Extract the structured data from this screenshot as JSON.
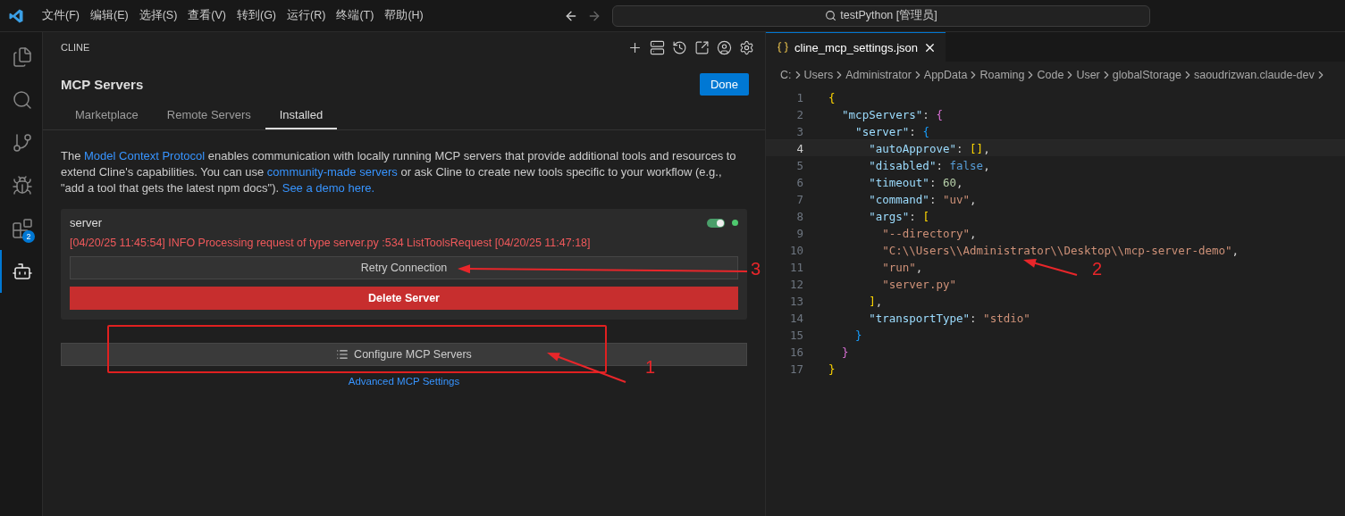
{
  "titlebar": {
    "menu": [
      "文件(F)",
      "编辑(E)",
      "选择(S)",
      "查看(V)",
      "转到(G)",
      "运行(R)",
      "终端(T)",
      "帮助(H)"
    ],
    "command_center": "testPython [管理员]"
  },
  "activity_bar": [
    {
      "kind": "explorer",
      "selected": false
    },
    {
      "kind": "search",
      "selected": false
    },
    {
      "kind": "source-control",
      "selected": false
    },
    {
      "kind": "run-debug",
      "selected": false
    },
    {
      "kind": "extensions",
      "selected": false,
      "badge": "2"
    },
    {
      "kind": "robot",
      "selected": true
    }
  ],
  "panel": {
    "title": "CLINE",
    "toolbar": [
      {
        "kind": "plus"
      },
      {
        "kind": "list"
      },
      {
        "kind": "history"
      },
      {
        "kind": "external"
      },
      {
        "kind": "account"
      },
      {
        "kind": "settings"
      }
    ],
    "heading": "MCP Servers",
    "done": "Done",
    "tabs": [
      {
        "label": "Marketplace",
        "selected": false
      },
      {
        "label": "Remote Servers",
        "selected": false
      },
      {
        "label": "Installed",
        "selected": true
      }
    ],
    "description": [
      {
        "text": "The ",
        "link": false
      },
      {
        "text": "Model Context Protocol",
        "link": true
      },
      {
        "text": " enables communication with locally running MCP servers that provide additional tools and resources to extend Cline's capabilities. You can use ",
        "link": false
      },
      {
        "text": "community-made servers",
        "link": true
      },
      {
        "text": " or ask Cline to create new tools specific to your workflow (e.g., \"add a tool that gets the latest npm docs\"). ",
        "link": false
      },
      {
        "text": "See a demo here.",
        "link": true
      }
    ],
    "server": {
      "name": "server",
      "on": true,
      "connected": true,
      "log": "[04/20/25 11:45:54] INFO Processing request of type server.py :534 ListToolsRequest [04/20/25 11:47:18]",
      "retry": "Retry Connection",
      "delete": "Delete Server"
    },
    "configure": "Configure MCP Servers",
    "advanced": "Advanced MCP Settings"
  },
  "editor": {
    "tab": "cline_mcp_settings.json",
    "breadcrumb": [
      "C:",
      "Users",
      "Administrator",
      "AppData",
      "Roaming",
      "Code",
      "User",
      "globalStorage",
      "saoudrizwan.claude-dev"
    ],
    "lines": [
      {
        "number": "1",
        "current": false,
        "tokens": [
          {
            "kind": "b1",
            "text": "{"
          }
        ]
      },
      {
        "number": "2",
        "current": false,
        "tokens": [
          {
            "kind": "key",
            "text": "  \"mcpServers\""
          },
          {
            "kind": "p",
            "text": ": "
          },
          {
            "kind": "b2",
            "text": "{"
          }
        ]
      },
      {
        "number": "3",
        "current": false,
        "tokens": [
          {
            "kind": "key",
            "text": "    \"server\""
          },
          {
            "kind": "p",
            "text": ": "
          },
          {
            "kind": "b3",
            "text": "{"
          }
        ]
      },
      {
        "number": "4",
        "current": true,
        "tokens": [
          {
            "kind": "key",
            "text": "      \"autoApprove\""
          },
          {
            "kind": "p",
            "text": ": "
          },
          {
            "kind": "b1",
            "text": "[]"
          },
          {
            "kind": "p",
            "text": ","
          }
        ]
      },
      {
        "number": "5",
        "current": false,
        "tokens": [
          {
            "kind": "key",
            "text": "      \"disabled\""
          },
          {
            "kind": "p",
            "text": ": "
          },
          {
            "kind": "kw",
            "text": "false"
          },
          {
            "kind": "p",
            "text": ","
          }
        ]
      },
      {
        "number": "6",
        "current": false,
        "tokens": [
          {
            "kind": "key",
            "text": "      \"timeout\""
          },
          {
            "kind": "p",
            "text": ": "
          },
          {
            "kind": "num",
            "text": "60"
          },
          {
            "kind": "p",
            "text": ","
          }
        ]
      },
      {
        "number": "7",
        "current": false,
        "tokens": [
          {
            "kind": "key",
            "text": "      \"command\""
          },
          {
            "kind": "p",
            "text": ": "
          },
          {
            "kind": "str",
            "text": "\"uv\""
          },
          {
            "kind": "p",
            "text": ","
          }
        ]
      },
      {
        "number": "8",
        "current": false,
        "tokens": [
          {
            "kind": "key",
            "text": "      \"args\""
          },
          {
            "kind": "p",
            "text": ": "
          },
          {
            "kind": "b1",
            "text": "["
          }
        ]
      },
      {
        "number": "9",
        "current": false,
        "tokens": [
          {
            "kind": "str",
            "text": "        \"--directory\""
          },
          {
            "kind": "p",
            "text": ","
          }
        ]
      },
      {
        "number": "10",
        "current": false,
        "tokens": [
          {
            "kind": "str",
            "text": "        \"C:\\\\Users\\\\Administrator\\\\Desktop\\\\mcp-server-demo\""
          },
          {
            "kind": "p",
            "text": ","
          }
        ]
      },
      {
        "number": "11",
        "current": false,
        "tokens": [
          {
            "kind": "str",
            "text": "        \"run\""
          },
          {
            "kind": "p",
            "text": ","
          }
        ]
      },
      {
        "number": "12",
        "current": false,
        "tokens": [
          {
            "kind": "str",
            "text": "        \"server.py\""
          }
        ]
      },
      {
        "number": "13",
        "current": false,
        "tokens": [
          {
            "kind": "b1",
            "text": "      ]"
          },
          {
            "kind": "p",
            "text": ","
          }
        ]
      },
      {
        "number": "14",
        "current": false,
        "tokens": [
          {
            "kind": "key",
            "text": "      \"transportType\""
          },
          {
            "kind": "p",
            "text": ": "
          },
          {
            "kind": "str",
            "text": "\"stdio\""
          }
        ]
      },
      {
        "number": "15",
        "current": false,
        "tokens": [
          {
            "kind": "b3",
            "text": "    }"
          }
        ]
      },
      {
        "number": "16",
        "current": false,
        "tokens": [
          {
            "kind": "b2",
            "text": "  }"
          }
        ]
      },
      {
        "number": "17",
        "current": false,
        "tokens": [
          {
            "kind": "b1",
            "text": "}"
          }
        ]
      }
    ]
  },
  "annotations": [
    {
      "label": "1"
    },
    {
      "label": "2"
    },
    {
      "label": "3"
    }
  ]
}
